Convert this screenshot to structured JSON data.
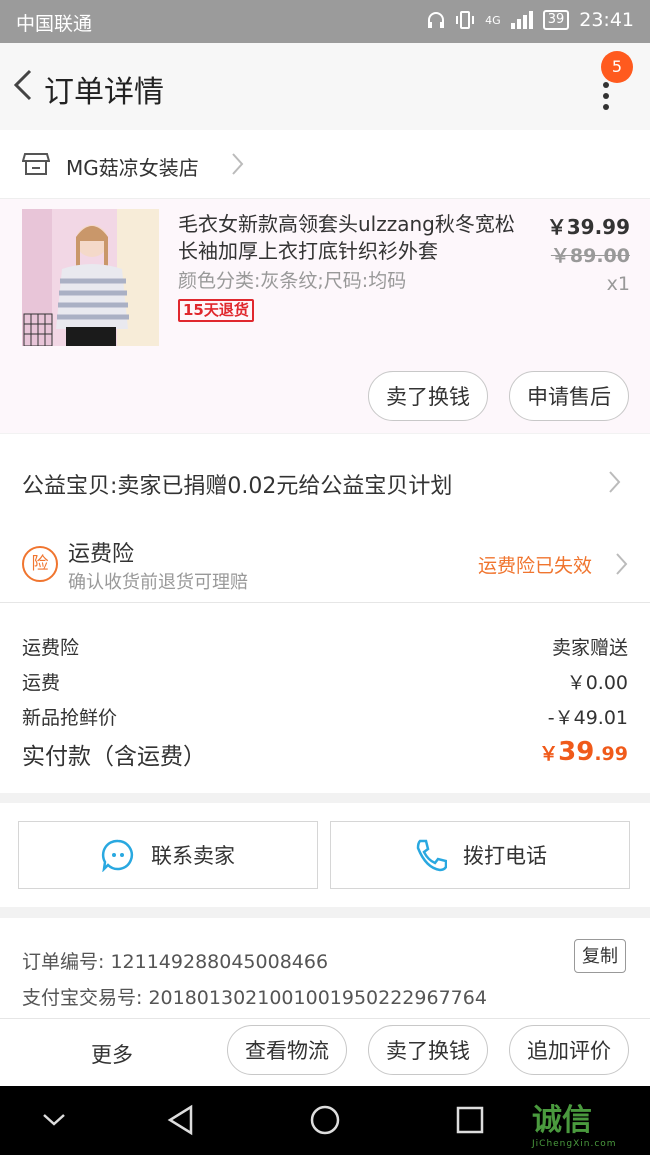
{
  "status_bar": {
    "carrier": "中国联通",
    "battery": "39",
    "time": "23:41",
    "signal": "4G"
  },
  "header": {
    "title": "订单详情",
    "badge_count": "5"
  },
  "shop": {
    "name": "MG菇凉女装店"
  },
  "product": {
    "title": "毛衣女新款高领套头ulzzang秋冬宽松长袖加厚上衣打底针织衫外套",
    "sku": "颜色分类:灰条纹;尺码:均码",
    "tag": "15天退货",
    "price": "￥39.99",
    "original_price": "￥89.00",
    "quantity": "x1",
    "buttons": [
      "卖了换钱",
      "申请售后"
    ]
  },
  "charity": {
    "text": "公益宝贝:卖家已捐赠0.02元给公益宝贝计划"
  },
  "insurance": {
    "icon_char": "险",
    "title": "运费险",
    "subtitle": "确认收货前退货可理赔",
    "status": "运费险已失效",
    "status_color": "#f0752f"
  },
  "costs": {
    "rows": [
      {
        "label": "运费险",
        "value": "卖家赠送"
      },
      {
        "label": "运费",
        "value": "￥0.00"
      },
      {
        "label": "新品抢鲜价",
        "value": "-￥49.01"
      }
    ],
    "total_label": "实付款（含运费）",
    "total_symbol": "￥",
    "total_int": "39",
    "total_dec": ".99",
    "accent_color": "#f05a1a"
  },
  "contact": {
    "seller": "联系卖家",
    "phone": "拨打电话"
  },
  "order_info": {
    "order_no_label": "订单编号: ",
    "order_no": "121149288045008466",
    "alipay_label": "支付宝交易号: ",
    "alipay_no": "2018013021001001950222967764",
    "copy_label": "复制"
  },
  "actions": {
    "more": "更多",
    "buttons": [
      "查看物流",
      "卖了换钱",
      "追加评价"
    ]
  },
  "watermark": {
    "brand": "诚信",
    "site": "JiChengXin.com"
  }
}
